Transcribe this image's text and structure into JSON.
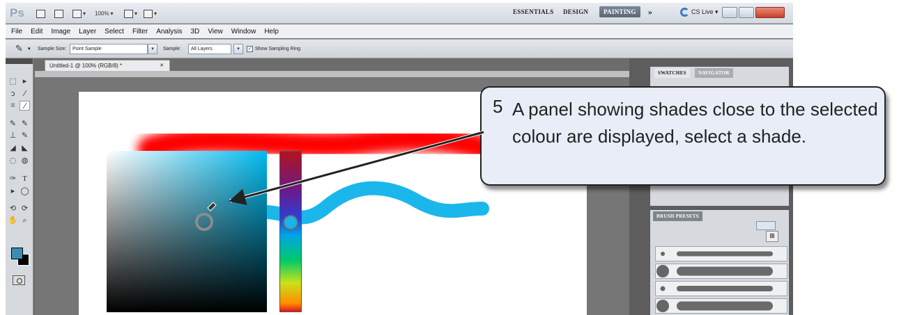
{
  "app": {
    "logo": "Ps"
  },
  "app_bar": {
    "zoom": "100%",
    "workspaces": [
      "ESSENTIALS",
      "DESIGN",
      "PAINTING"
    ],
    "active_workspace": "PAINTING",
    "more": "»",
    "cs_live": "CS Live ▾"
  },
  "menu": [
    "File",
    "Edit",
    "Image",
    "Layer",
    "Select",
    "Filter",
    "Analysis",
    "3D",
    "View",
    "Window",
    "Help"
  ],
  "options_bar": {
    "sample_size_label": "Sample Size:",
    "sample_size_value": "Point Sample",
    "sample_label": "Sample:",
    "sample_value": "All Layers",
    "show_ring_label": "Show Sampling Ring",
    "show_ring_checked": true
  },
  "document": {
    "tab_title": "Untitled-1 @ 100% (RGB/8) *"
  },
  "panels": {
    "swatches_tab": "SWATCHES",
    "navigator_tab": "NAVIGATOR",
    "brush_presets_tab": "BRUSH PRESETS"
  },
  "colors": {
    "foreground": "#3c8bb4",
    "background": "#000000",
    "picker_hue": "#00bbf0",
    "red_stroke": "#ff0000",
    "blue_stroke": "#1bb7ea",
    "accent": "#5d6775"
  },
  "icons": [
    "eyedropper-icon",
    "marquee-icon",
    "move-icon",
    "lasso-icon",
    "quick-select-icon",
    "crop-icon",
    "brush-icon",
    "stamp-icon",
    "eraser-icon",
    "pen-icon",
    "type-icon",
    "hand-icon",
    "zoom-icon"
  ],
  "callout": {
    "number": "5",
    "text": "A panel showing shades close to the selected colour are displayed, select a shade."
  }
}
